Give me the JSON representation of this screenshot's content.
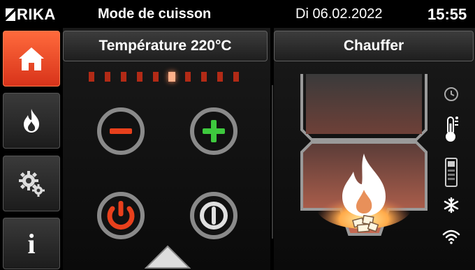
{
  "header": {
    "logo_text": "RIKA",
    "title": "Mode de cuisson",
    "date": "Di 06.02.2022",
    "time": "15:55"
  },
  "sidebar": {
    "items": [
      {
        "icon": "home-icon",
        "active": true
      },
      {
        "icon": "flame-icon",
        "active": false
      },
      {
        "icon": "gears-icon",
        "active": false
      },
      {
        "icon": "info-icon",
        "active": false,
        "label": "i"
      }
    ]
  },
  "left_panel": {
    "tab_label": "Température 220°C",
    "temperature_level": {
      "lit_index": 5,
      "count": 10
    }
  },
  "right_panel": {
    "tab_label": "Chauffer"
  },
  "colors": {
    "accent_orange": "#e8401c",
    "minus_red": "#e8401c",
    "plus_green": "#3ec93e",
    "button_grey": "#8a8a8a"
  },
  "status_icons": [
    "clock-icon",
    "thermometer-icon",
    "remote-icon",
    "snowflake-icon",
    "wifi-icon"
  ]
}
